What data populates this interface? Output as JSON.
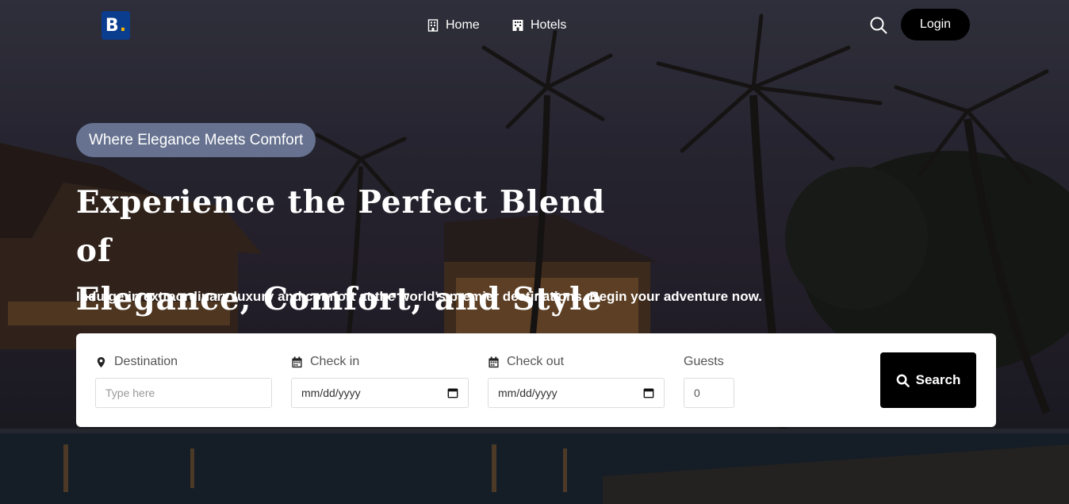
{
  "brand": {
    "logo_letter": "B",
    "logo_dot": ".",
    "logo_color": "#0b3d8f"
  },
  "nav": {
    "links": [
      {
        "label": "Home",
        "icon": "building-icon"
      },
      {
        "label": "Hotels",
        "icon": "hotel-icon"
      }
    ],
    "search_icon": "search-icon",
    "login_label": "Login"
  },
  "hero": {
    "badge": "Where Elegance Meets Comfort",
    "title_line1": "Experience the Perfect Blend of",
    "title_line2": "Elegance, Comfort, and Style",
    "subtitle": "Indulge in extraordinary luxury and comfort at the world's premier destinations. Begin your adventure now."
  },
  "search_form": {
    "destination": {
      "label": "Destination",
      "icon": "map-pin-icon",
      "placeholder": "Type here"
    },
    "check_in": {
      "label": "Check in",
      "icon": "calendar-icon",
      "value": "mm/dd/yyyy"
    },
    "check_out": {
      "label": "Check out",
      "icon": "calendar-icon",
      "value": "mm/dd/yyyy"
    },
    "guests": {
      "label": "Guests",
      "value": "0"
    },
    "submit_label": "Search"
  }
}
